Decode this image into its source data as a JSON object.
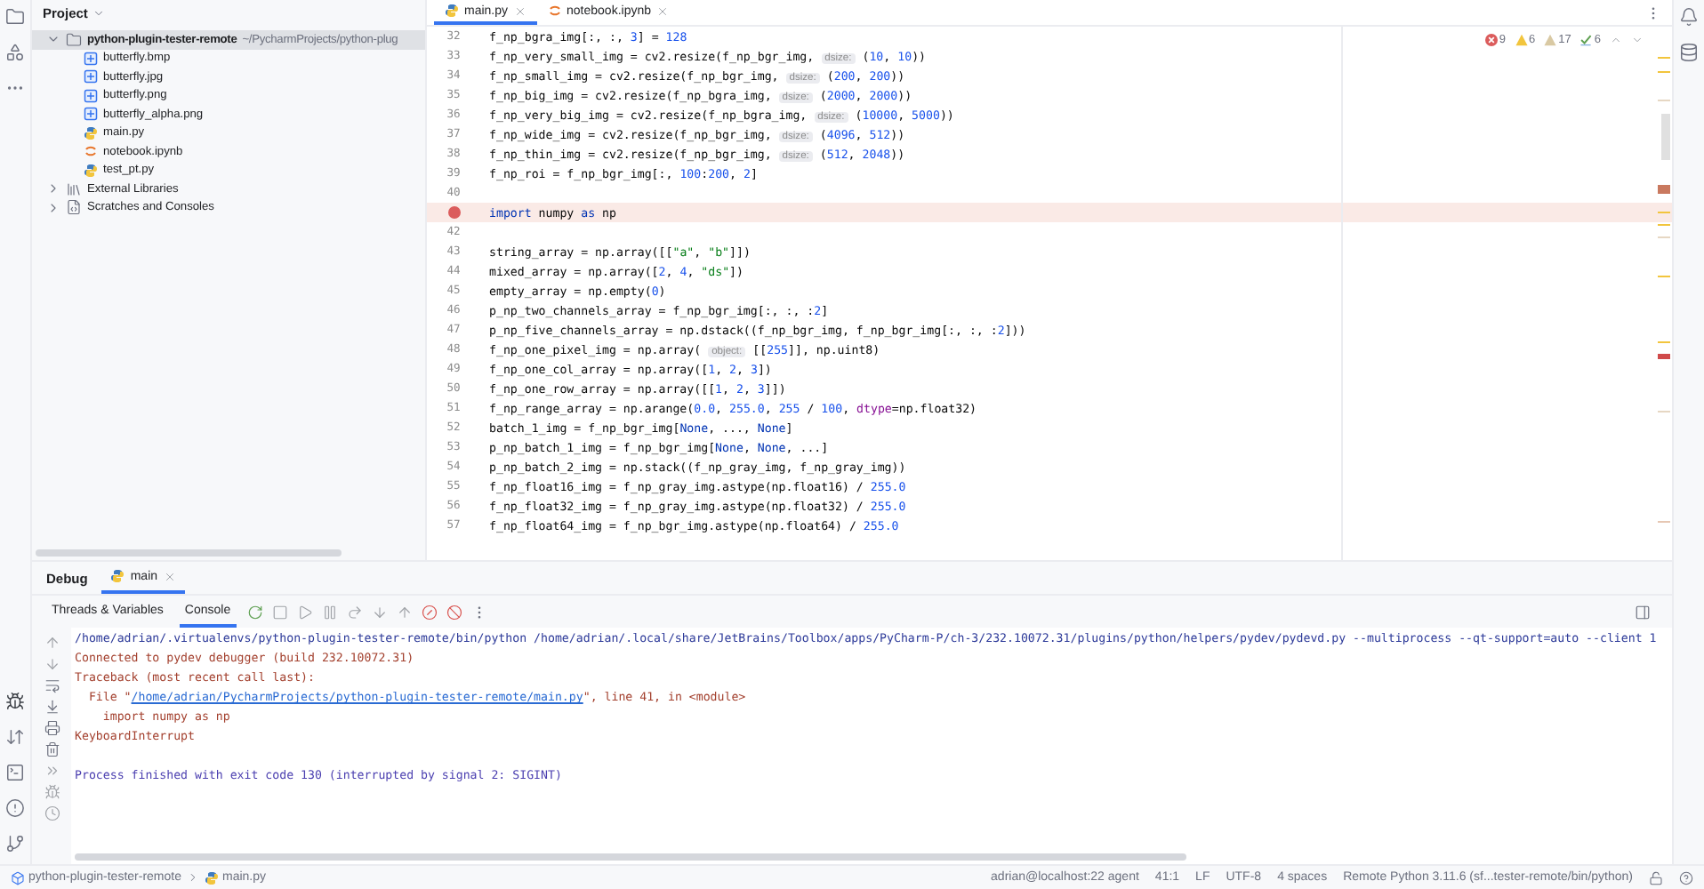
{
  "project_panel": {
    "title": "Project",
    "tree": [
      {
        "label": "python-plugin-tester-remote",
        "path": "~/PycharmProjects/python-plug",
        "kind": "folder",
        "expanded": true,
        "selected": true,
        "children": [
          {
            "label": "butterfly.bmp",
            "kind": "image"
          },
          {
            "label": "butterfly.jpg",
            "kind": "image"
          },
          {
            "label": "butterfly.png",
            "kind": "image"
          },
          {
            "label": "butterfly_alpha.png",
            "kind": "image"
          },
          {
            "label": "main.py",
            "kind": "python"
          },
          {
            "label": "notebook.ipynb",
            "kind": "notebook"
          },
          {
            "label": "test_pt.py",
            "kind": "python"
          }
        ]
      },
      {
        "label": "External Libraries",
        "kind": "library",
        "expanded": false,
        "selected": false
      },
      {
        "label": "Scratches and Consoles",
        "kind": "scratch",
        "expanded": false,
        "selected": false
      }
    ]
  },
  "editor_tabs": [
    {
      "label": "main.py",
      "kind": "python",
      "selected": true
    },
    {
      "label": "notebook.ipynb",
      "kind": "notebook",
      "selected": false
    }
  ],
  "inspections": [
    {
      "kind": "error",
      "count": "9"
    },
    {
      "kind": "warning",
      "count": "6"
    },
    {
      "kind": "weak",
      "count": "17"
    },
    {
      "kind": "ok",
      "count": "6"
    }
  ],
  "code_lines": [
    {
      "number": "32",
      "breakpoint": false,
      "tokens": [
        {
          "kind": "plain",
          "text": "f_np_bgra_img[:, :, "
        },
        {
          "kind": "number",
          "text": "3"
        },
        {
          "kind": "plain",
          "text": "] = "
        },
        {
          "kind": "number",
          "text": "128"
        }
      ]
    },
    {
      "number": "33",
      "breakpoint": false,
      "tokens": [
        {
          "kind": "plain",
          "text": "f_np_very_small_img = cv2.resize(f_np_bgr_img, "
        },
        {
          "kind": "hint",
          "text": "dsize:"
        },
        {
          "kind": "plain",
          "text": " ("
        },
        {
          "kind": "number",
          "text": "10"
        },
        {
          "kind": "plain",
          "text": ", "
        },
        {
          "kind": "number",
          "text": "10"
        },
        {
          "kind": "plain",
          "text": "))"
        }
      ]
    },
    {
      "number": "34",
      "breakpoint": false,
      "tokens": [
        {
          "kind": "plain",
          "text": "f_np_small_img = cv2.resize(f_np_bgr_img, "
        },
        {
          "kind": "hint",
          "text": "dsize:"
        },
        {
          "kind": "plain",
          "text": " ("
        },
        {
          "kind": "number",
          "text": "200"
        },
        {
          "kind": "plain",
          "text": ", "
        },
        {
          "kind": "number",
          "text": "200"
        },
        {
          "kind": "plain",
          "text": "))"
        }
      ]
    },
    {
      "number": "35",
      "breakpoint": false,
      "tokens": [
        {
          "kind": "plain",
          "text": "f_np_big_img = cv2.resize(f_np_bgra_img, "
        },
        {
          "kind": "hint",
          "text": "dsize:"
        },
        {
          "kind": "plain",
          "text": " ("
        },
        {
          "kind": "number",
          "text": "2000"
        },
        {
          "kind": "plain",
          "text": ", "
        },
        {
          "kind": "number",
          "text": "2000"
        },
        {
          "kind": "plain",
          "text": "))"
        }
      ]
    },
    {
      "number": "36",
      "breakpoint": false,
      "tokens": [
        {
          "kind": "plain",
          "text": "f_np_very_big_img = cv2.resize(f_np_bgra_img, "
        },
        {
          "kind": "hint",
          "text": "dsize:"
        },
        {
          "kind": "plain",
          "text": " ("
        },
        {
          "kind": "number",
          "text": "10000"
        },
        {
          "kind": "plain",
          "text": ", "
        },
        {
          "kind": "number",
          "text": "5000"
        },
        {
          "kind": "plain",
          "text": "))"
        }
      ]
    },
    {
      "number": "37",
      "breakpoint": false,
      "tokens": [
        {
          "kind": "plain",
          "text": "f_np_wide_img = cv2.resize(f_np_bgr_img, "
        },
        {
          "kind": "hint",
          "text": "dsize:"
        },
        {
          "kind": "plain",
          "text": " ("
        },
        {
          "kind": "number",
          "text": "4096"
        },
        {
          "kind": "plain",
          "text": ", "
        },
        {
          "kind": "number",
          "text": "512"
        },
        {
          "kind": "plain",
          "text": "))"
        }
      ]
    },
    {
      "number": "38",
      "breakpoint": false,
      "tokens": [
        {
          "kind": "plain",
          "text": "f_np_thin_img = cv2.resize(f_np_bgr_img, "
        },
        {
          "kind": "hint",
          "text": "dsize:"
        },
        {
          "kind": "plain",
          "text": " ("
        },
        {
          "kind": "number",
          "text": "512"
        },
        {
          "kind": "plain",
          "text": ", "
        },
        {
          "kind": "number",
          "text": "2048"
        },
        {
          "kind": "plain",
          "text": "))"
        }
      ]
    },
    {
      "number": "39",
      "breakpoint": false,
      "tokens": [
        {
          "kind": "plain",
          "text": "f_np_roi = f_np_bgr_img[:, "
        },
        {
          "kind": "number",
          "text": "100"
        },
        {
          "kind": "plain",
          "text": ":"
        },
        {
          "kind": "number",
          "text": "200"
        },
        {
          "kind": "plain",
          "text": ", "
        },
        {
          "kind": "number",
          "text": "2"
        },
        {
          "kind": "plain",
          "text": "]"
        }
      ]
    },
    {
      "number": "40",
      "breakpoint": false
    },
    {
      "breakpoint": true,
      "tokens": [
        {
          "kind": "keyword",
          "text": "import"
        },
        {
          "kind": "plain",
          "text": " numpy "
        },
        {
          "kind": "keyword",
          "text": "as"
        },
        {
          "kind": "plain",
          "text": " np"
        }
      ]
    },
    {
      "number": "42",
      "breakpoint": false
    },
    {
      "number": "43",
      "breakpoint": false,
      "tokens": [
        {
          "kind": "plain",
          "text": "string_array = np.array([["
        },
        {
          "kind": "string",
          "text": "\"a\""
        },
        {
          "kind": "plain",
          "text": ", "
        },
        {
          "kind": "string",
          "text": "\"b\""
        },
        {
          "kind": "plain",
          "text": "]])"
        }
      ]
    },
    {
      "number": "44",
      "breakpoint": false,
      "tokens": [
        {
          "kind": "plain",
          "text": "mixed_array = np.array(["
        },
        {
          "kind": "number",
          "text": "2"
        },
        {
          "kind": "plain",
          "text": ", "
        },
        {
          "kind": "number",
          "text": "4"
        },
        {
          "kind": "plain",
          "text": ", "
        },
        {
          "kind": "string",
          "text": "\"ds\""
        },
        {
          "kind": "plain",
          "text": "])"
        }
      ]
    },
    {
      "number": "45",
      "breakpoint": false,
      "tokens": [
        {
          "kind": "plain",
          "text": "empty_array = np.empty("
        },
        {
          "kind": "number",
          "text": "0"
        },
        {
          "kind": "plain",
          "text": ")"
        }
      ]
    },
    {
      "number": "46",
      "breakpoint": false,
      "tokens": [
        {
          "kind": "plain",
          "text": "p_np_two_channels_array = f_np_bgr_img[:, :, :"
        },
        {
          "kind": "number",
          "text": "2"
        },
        {
          "kind": "plain",
          "text": "]"
        }
      ]
    },
    {
      "number": "47",
      "breakpoint": false,
      "tokens": [
        {
          "kind": "plain",
          "text": "p_np_five_channels_array = np.dstack((f_np_bgr_img, f_np_bgr_img[:, :, :"
        },
        {
          "kind": "number",
          "text": "2"
        },
        {
          "kind": "plain",
          "text": "]))"
        }
      ]
    },
    {
      "number": "48",
      "breakpoint": false,
      "tokens": [
        {
          "kind": "plain",
          "text": "f_np_one_pixel_img = np.array( "
        },
        {
          "kind": "hint",
          "text": "object:"
        },
        {
          "kind": "plain",
          "text": " [["
        },
        {
          "kind": "number",
          "text": "255"
        },
        {
          "kind": "plain",
          "text": "]], np.uint8)"
        }
      ]
    },
    {
      "number": "49",
      "breakpoint": false,
      "tokens": [
        {
          "kind": "plain",
          "text": "f_np_one_col_array = np.array(["
        },
        {
          "kind": "number",
          "text": "1"
        },
        {
          "kind": "plain",
          "text": ", "
        },
        {
          "kind": "number",
          "text": "2"
        },
        {
          "kind": "plain",
          "text": ", "
        },
        {
          "kind": "number",
          "text": "3"
        },
        {
          "kind": "plain",
          "text": "])"
        }
      ]
    },
    {
      "number": "50",
      "breakpoint": false,
      "tokens": [
        {
          "kind": "plain",
          "text": "f_np_one_row_array = np.array([["
        },
        {
          "kind": "number",
          "text": "1"
        },
        {
          "kind": "plain",
          "text": ", "
        },
        {
          "kind": "number",
          "text": "2"
        },
        {
          "kind": "plain",
          "text": ", "
        },
        {
          "kind": "number",
          "text": "3"
        },
        {
          "kind": "plain",
          "text": "]])"
        }
      ]
    },
    {
      "number": "51",
      "breakpoint": false,
      "tokens": [
        {
          "kind": "plain",
          "text": "f_np_range_array = np.arange("
        },
        {
          "kind": "number",
          "text": "0.0"
        },
        {
          "kind": "plain",
          "text": ", "
        },
        {
          "kind": "number",
          "text": "255.0"
        },
        {
          "kind": "plain",
          "text": ", "
        },
        {
          "kind": "number",
          "text": "255"
        },
        {
          "kind": "plain",
          "text": " / "
        },
        {
          "kind": "number",
          "text": "100"
        },
        {
          "kind": "plain",
          "text": ", "
        },
        {
          "kind": "param",
          "text": "dtype"
        },
        {
          "kind": "plain",
          "text": "=np.float32)"
        }
      ]
    },
    {
      "number": "52",
      "breakpoint": false,
      "tokens": [
        {
          "kind": "plain",
          "text": "batch_1_img = f_np_bgr_img["
        },
        {
          "kind": "keyword",
          "text": "None"
        },
        {
          "kind": "plain",
          "text": ", ..., "
        },
        {
          "kind": "keyword",
          "text": "None"
        },
        {
          "kind": "plain",
          "text": "]"
        }
      ]
    },
    {
      "number": "53",
      "breakpoint": false,
      "tokens": [
        {
          "kind": "plain",
          "text": "p_np_batch_1_img = f_np_bgr_img["
        },
        {
          "kind": "keyword",
          "text": "None"
        },
        {
          "kind": "plain",
          "text": ", "
        },
        {
          "kind": "keyword",
          "text": "None"
        },
        {
          "kind": "plain",
          "text": ", ...]"
        }
      ]
    },
    {
      "number": "54",
      "breakpoint": false,
      "tokens": [
        {
          "kind": "plain",
          "text": "p_np_batch_2_img = np.stack((f_np_gray_img, f_np_gray_img))"
        }
      ]
    },
    {
      "number": "55",
      "breakpoint": false,
      "tokens": [
        {
          "kind": "plain",
          "text": "f_np_float16_img = f_np_gray_img.astype(np.float16) / "
        },
        {
          "kind": "number",
          "text": "255.0"
        }
      ]
    },
    {
      "number": "56",
      "breakpoint": false,
      "tokens": [
        {
          "kind": "plain",
          "text": "f_np_float32_img = f_np_gray_img.astype(np.float32) / "
        },
        {
          "kind": "number",
          "text": "255.0"
        }
      ]
    },
    {
      "number": "57",
      "breakpoint": false,
      "tokens": [
        {
          "kind": "plain",
          "text": "f_np_float64_img = f_np_bgr_img.astype(np.float64) / "
        },
        {
          "kind": "number",
          "text": "255.0"
        }
      ]
    }
  ],
  "debug_panel": {
    "title": "Debug",
    "tabs": [
      {
        "label": "main",
        "selected": true
      }
    ],
    "subtabs": [
      {
        "label": "Threads & Variables",
        "selected": false
      },
      {
        "label": "Console",
        "selected": true
      }
    ],
    "console_lines": [
      {
        "kind": "output",
        "segments": [
          {
            "kind": "command",
            "text": "/home/adrian/.virtualenvs/python-plugin-tester-remote/bin/python /home/adrian/.local/share/JetBrains/Toolbox/apps/PyCharm-P/ch-3/232.10072.31/plugins/python/helpers/pydev/pydevd.py --multiprocess --qt-support=auto --client 1"
          }
        ]
      },
      {
        "kind": "output",
        "segments": [
          {
            "kind": "stderr",
            "text": "Connected to pydev debugger (build 232.10072.31)"
          }
        ]
      },
      {
        "kind": "output",
        "segments": [
          {
            "kind": "stderr",
            "text": "Traceback (most recent call last):"
          }
        ]
      },
      {
        "kind": "output",
        "segments": [
          {
            "kind": "stderr",
            "text": "  File \""
          },
          {
            "kind": "link",
            "text": "/home/adrian/PycharmProjects/python-plugin-tester-remote/main.py"
          },
          {
            "kind": "stderr",
            "text": "\", line 41, in <module>"
          }
        ]
      },
      {
        "kind": "output",
        "segments": [
          {
            "kind": "stderr",
            "text": "    import numpy as np"
          }
        ]
      },
      {
        "kind": "output",
        "segments": [
          {
            "kind": "stderr",
            "text": "KeyboardInterrupt"
          }
        ]
      },
      {
        "kind": "exit_status",
        "segments": [
          {
            "kind": "system",
            "text": "Process finished with exit code 130 (interrupted by signal 2: SIGINT)"
          }
        ]
      }
    ]
  },
  "status_bar": {
    "breadcrumbs": [
      {
        "label": "python-plugin-tester-remote",
        "kind": "module"
      },
      {
        "label": "main.py",
        "kind": "python"
      }
    ],
    "items": [
      "adrian@localhost:22 agent",
      "41:1",
      "LF",
      "UTF-8",
      "4 spaces",
      "Remote Python 3.11.6 (sf...tester-remote/bin/python)"
    ]
  }
}
